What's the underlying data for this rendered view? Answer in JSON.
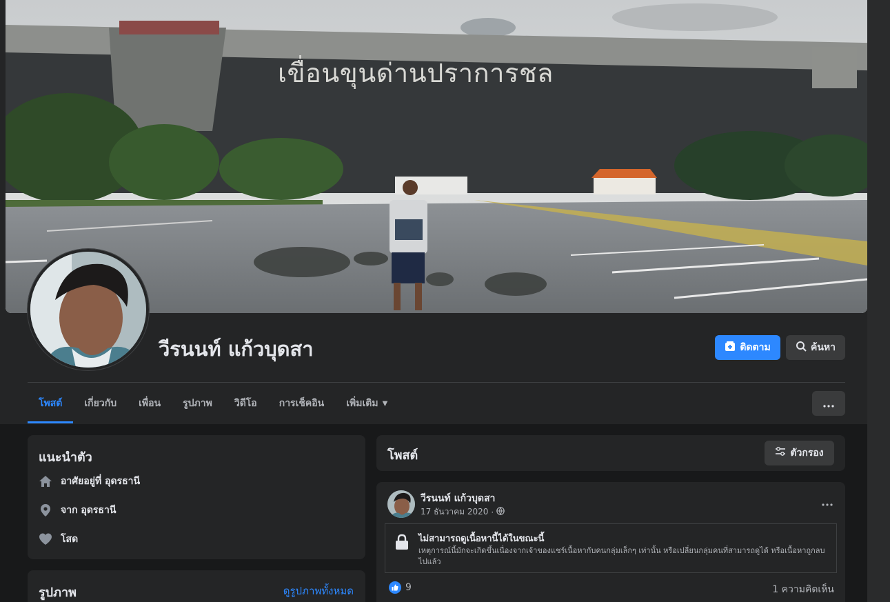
{
  "cover": {
    "sign_text": "เขื่อนขุนด่านปราการชล"
  },
  "profile": {
    "name": "วีรนนท์ แก้วบุดสา",
    "follow_label": "ติดตาม",
    "search_label": "ค้นหา"
  },
  "tabs": [
    {
      "label": "โพสต์",
      "active": true
    },
    {
      "label": "เกี่ยวกับ"
    },
    {
      "label": "เพื่อน"
    },
    {
      "label": "รูปภาพ"
    },
    {
      "label": "วิดีโอ"
    },
    {
      "label": "การเช็คอิน"
    },
    {
      "label": "เพิ่มเติม"
    }
  ],
  "intro": {
    "title": "แนะนำตัว",
    "items": [
      {
        "icon": "home-icon",
        "text": "อาศัยอยู่ที่ อุดรธานี"
      },
      {
        "icon": "location-pin-icon",
        "text": "จาก อุดรธานี"
      },
      {
        "icon": "heart-icon",
        "text": "โสด"
      }
    ]
  },
  "photos": {
    "title": "รูปภาพ",
    "see_all": "ดูรูปภาพทั้งหมด"
  },
  "posts": {
    "title": "โพสต์",
    "filter_label": "ตัวกรอง"
  },
  "post": {
    "author": "วีรนนท์ แก้วบุดสา",
    "date": "17 ธันวาคม 2020",
    "locked_title": "ไม่สามารถดูเนื้อหานี้ได้ในขณะนี้",
    "locked_desc": "เหตุการณ์นี้มักจะเกิดขึ้นเนื่องจากเจ้าของแชร์เนื้อหากับคนกลุ่มเล็กๆ เท่านั้น หรือเปลี่ยนกลุ่มคนที่สามารถดูได้ หรือเนื้อหาถูกลบไปแล้ว",
    "likes": "9",
    "comments": "1 ความคิดเห็น"
  },
  "colors": {
    "accent": "#2d88ff",
    "card": "#242526",
    "background": "#18191a"
  }
}
